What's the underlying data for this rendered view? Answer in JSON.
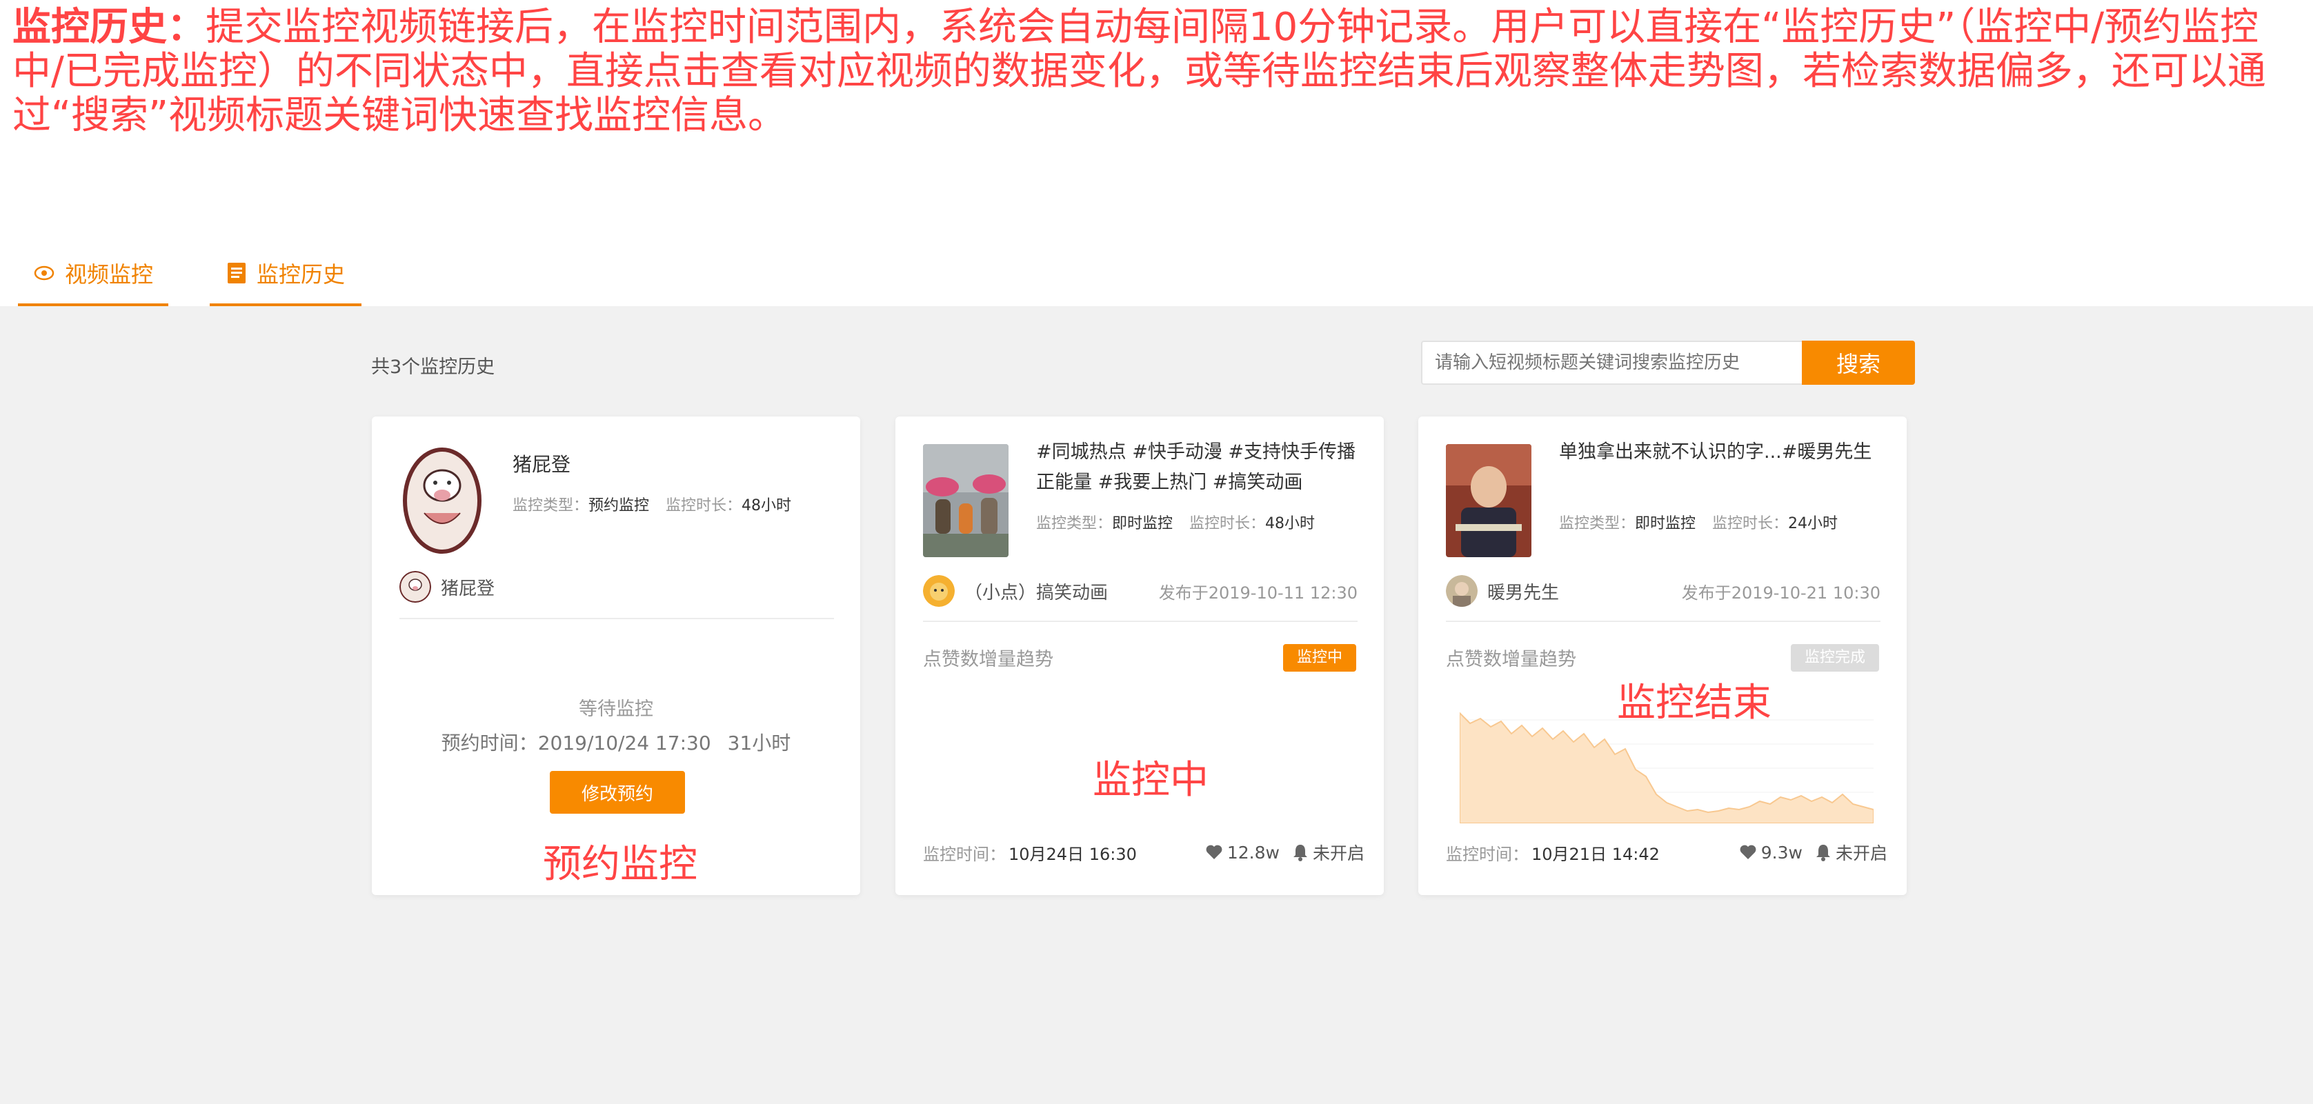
{
  "intro": {
    "title": "监控历史：",
    "text": "提交监控视频链接后，在监控时间范围内，系统会自动每间隔10分钟记录。用户可以直接在“监控历史”（监控中/预约监控中/已完成监控）的不同状态中，直接点击查看对应视频的数据变化，或等待监控结束后观察整体走势图，若检索数据偏多，还可以通过“搜索”视频标题关键词快速查找监控信息。"
  },
  "tabs": [
    {
      "label": "视频监控",
      "icon": "eye-icon"
    },
    {
      "label": "监控历史",
      "icon": "document-icon"
    }
  ],
  "count_text": "共3个监控历史",
  "search": {
    "placeholder": "请输入短视频标题关键词搜索监控历史",
    "button": "搜索"
  },
  "colors": {
    "accent": "#f88a00",
    "annotation": "#ff4444"
  },
  "cards": [
    {
      "name": "猪屁登",
      "type_label": "监控类型：",
      "type": "预约监控",
      "duration_label": "监控时长：",
      "duration": "48小时",
      "author": "猪屁登",
      "status_title": "等待监控",
      "schedule_label": "预约时间：",
      "schedule": "2019/10/24 17:30",
      "schedule_hours": "31小时",
      "button": "修改预约",
      "overlay": "预约监控"
    },
    {
      "title": "#同城热点 #快手动漫 #支持快手传播正能量 #我要上热门 #搞笑动画",
      "type_label": "监控类型：",
      "type": "即时监控",
      "duration_label": "监控时长：",
      "duration": "48小时",
      "author": "（小点）搞笑动画",
      "published": "发布于2019-10-11 12:30",
      "trend_label": "点赞数增量趋势",
      "badge": "监控中",
      "monitor_label": "监控时间：",
      "monitor_time": "10月24日 16:30",
      "likes": "12.8w",
      "alert": "未开启",
      "overlay": "监控中"
    },
    {
      "title": "单独拿出来就不认识的字...#暖男先生",
      "type_label": "监控类型：",
      "type": "即时监控",
      "duration_label": "监控时长：",
      "duration": "24小时",
      "author": "暖男先生",
      "published": "发布于2019-10-21 10:30",
      "trend_label": "点赞数增量趋势",
      "badge": "监控完成",
      "monitor_label": "监控时间：",
      "monitor_time": "10月21日 14:42",
      "likes": "9.3w",
      "alert": "未开启",
      "overlay": "监控结束"
    }
  ]
}
